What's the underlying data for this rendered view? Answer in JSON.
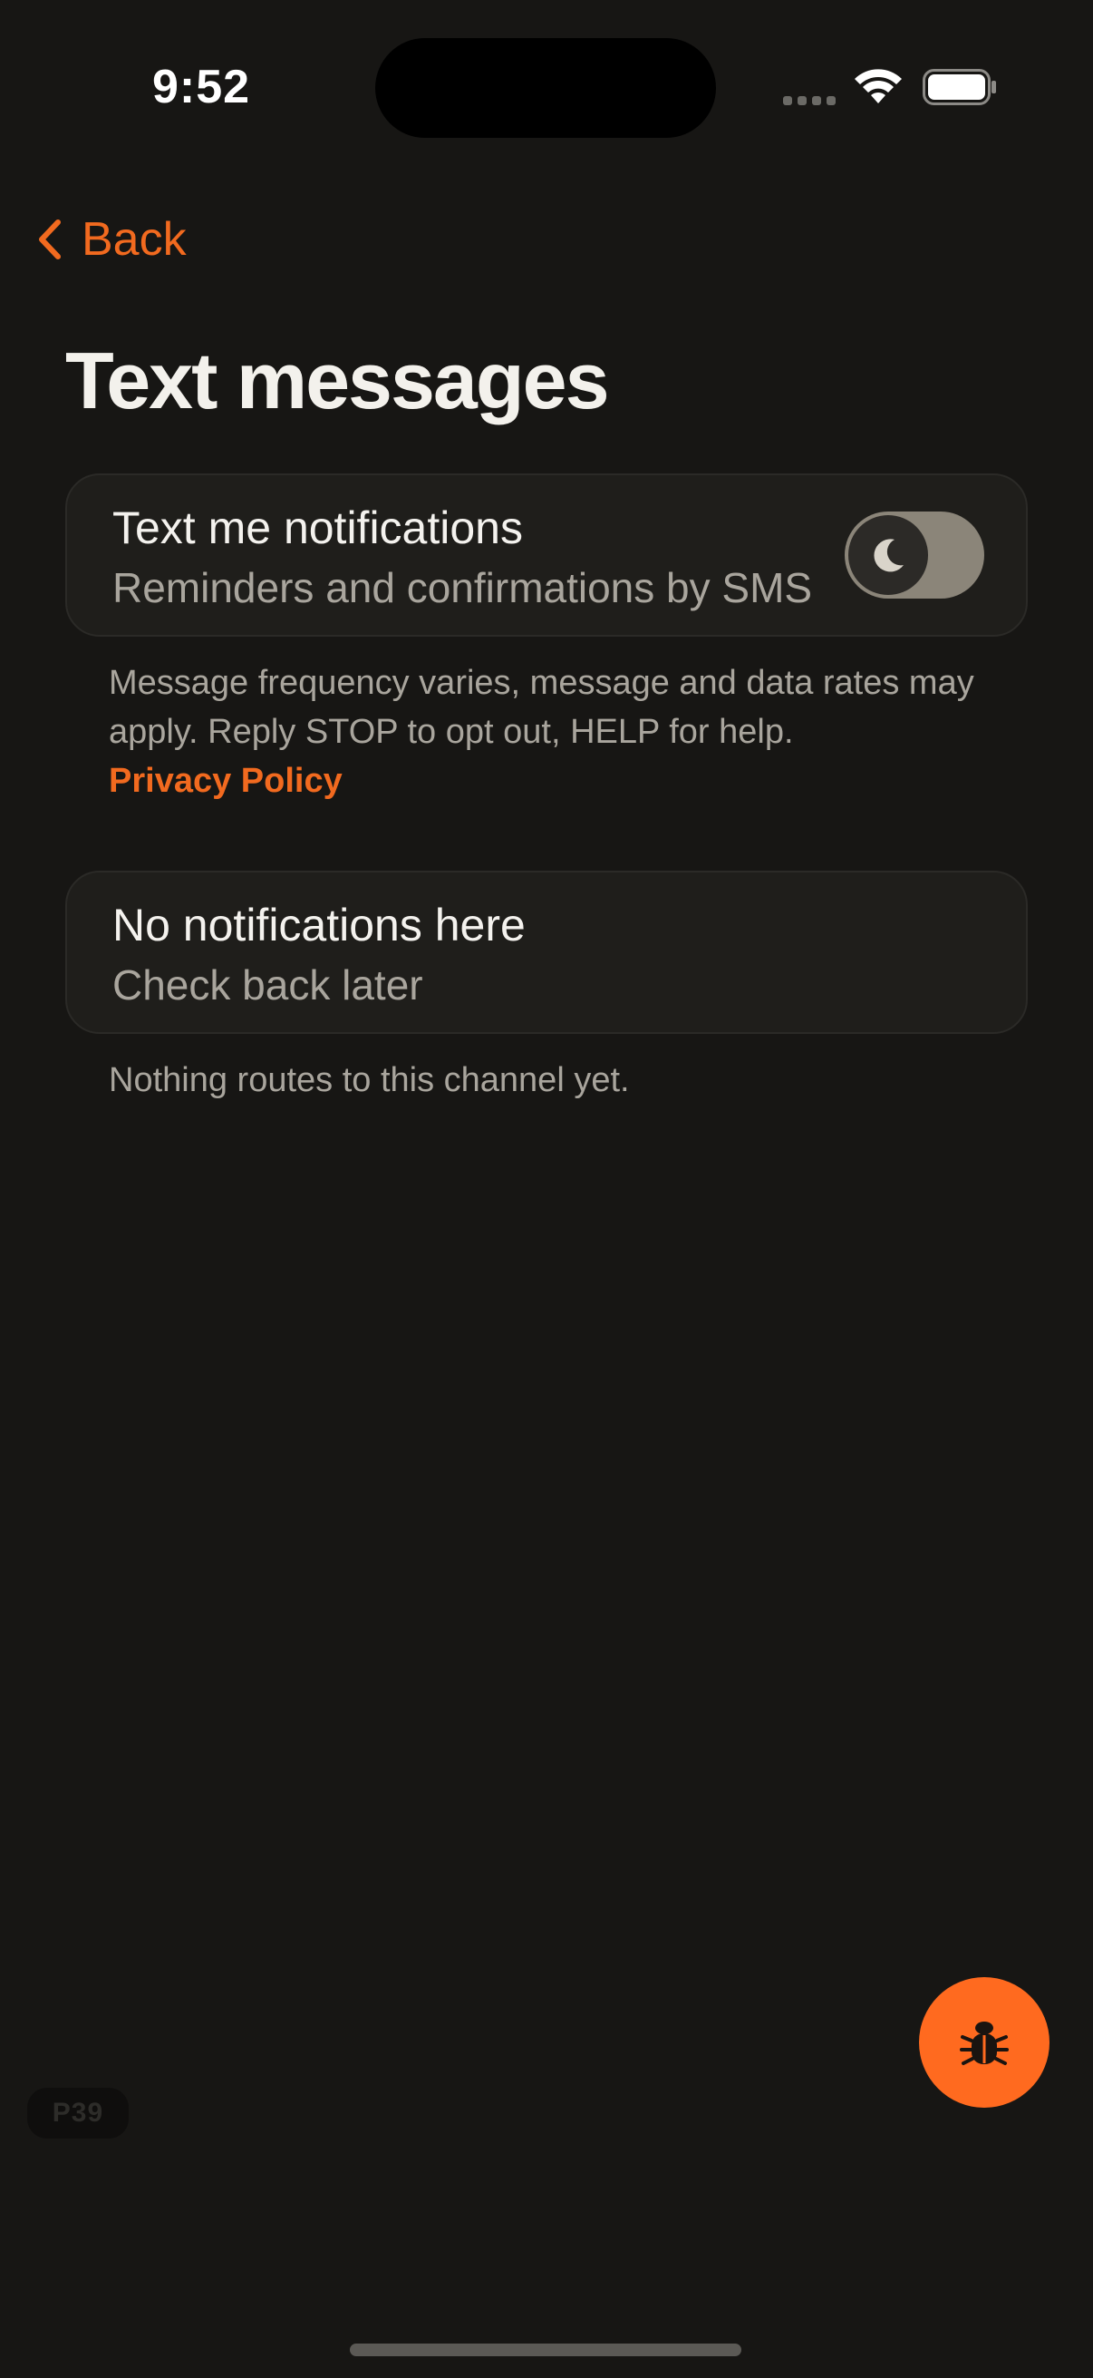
{
  "status_bar": {
    "time": "9:52",
    "signal_icon": "cellular-signal-icon",
    "wifi_icon": "wifi-icon",
    "battery_icon": "battery-icon"
  },
  "nav": {
    "back_label": "Back",
    "back_icon": "chevron-left-icon"
  },
  "page": {
    "title": "Text messages"
  },
  "sms_card": {
    "title": "Text me notifications",
    "subtitle": "Reminders and confirmations by SMS",
    "toggle_on": false,
    "toggle_icon": "moon-icon"
  },
  "sms_note": {
    "text": "Message frequency varies, message and data rates may apply. Reply STOP to opt out, HELP for help.",
    "link_label": "Privacy Policy"
  },
  "empty_card": {
    "title": "No notifications here",
    "subtitle": "Check back later"
  },
  "empty_note": {
    "text": "Nothing routes to this channel yet."
  },
  "debug": {
    "fab_icon": "bug-icon",
    "page_code": "P39"
  },
  "colors": {
    "background": "#171614",
    "accent": "#f26a1f",
    "fab": "#ff6a1f",
    "card": "#1f1e1b",
    "text_primary": "#f4f2ee",
    "text_secondary": "#a9a59d"
  }
}
